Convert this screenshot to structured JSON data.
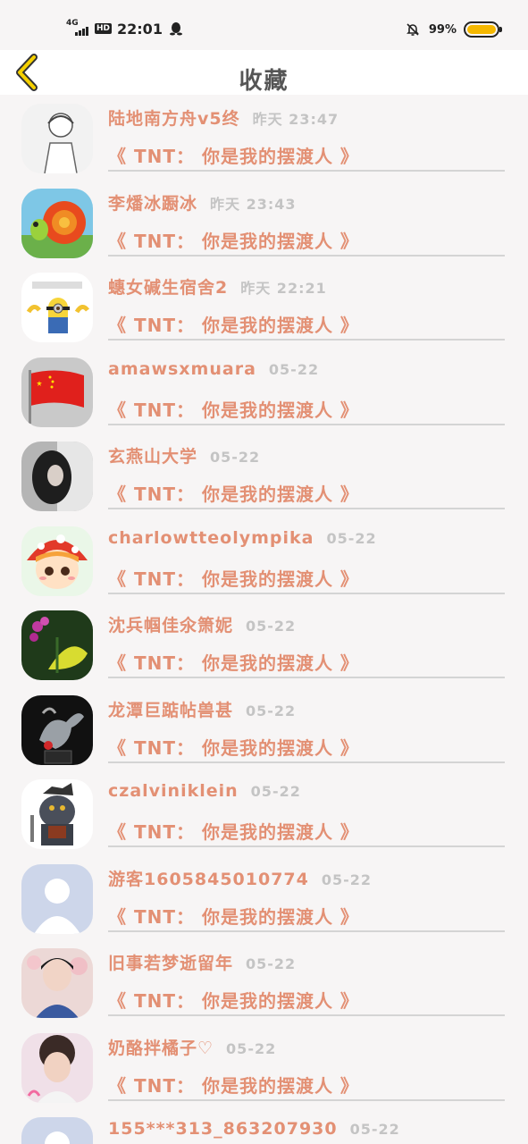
{
  "status_bar": {
    "network": "4G",
    "hd": "HD",
    "time": "22:01",
    "battery_pct": "99%",
    "battery_level": 0.99,
    "icons": [
      "signal-icon",
      "qq-penguin-icon",
      "bell-off-icon",
      "battery-icon"
    ]
  },
  "header": {
    "title": "收藏",
    "back_icon": "chevron-left-icon",
    "accent": "#f5d000"
  },
  "colors": {
    "name": "#e39074",
    "time": "#c4c4c4",
    "background": "#f7f5f5"
  },
  "items": [
    {
      "name": "陆地南方舟v5终",
      "time": "昨天 23:47",
      "book": "《 TNT： 你是我的摆渡人 》",
      "avatar": "sketch-boy"
    },
    {
      "name": "李燔冰蹰冰",
      "time": "昨天 23:43",
      "book": "《 TNT： 你是我的摆渡人 》",
      "avatar": "snail"
    },
    {
      "name": "蟪女碱生宿舍2",
      "time": "昨天 22:21",
      "book": "《 TNT： 你是我的摆渡人 》",
      "avatar": "minion"
    },
    {
      "name": "amawsxmuara",
      "time": "05-22",
      "book": "《 TNT： 你是我的摆渡人 》",
      "avatar": "flag"
    },
    {
      "name": "玄燕山大学",
      "time": "05-22",
      "book": "《 TNT： 你是我的摆渡人 》",
      "avatar": "girl-dark"
    },
    {
      "name": "charlowtteolympika",
      "time": "05-22",
      "book": "《 TNT： 你是我的摆渡人 》",
      "avatar": "mushroom-girl"
    },
    {
      "name": "沈兵帼佳氽箫妮",
      "time": "05-22",
      "book": "《 TNT： 你是我的摆渡人 》",
      "avatar": "butterfly"
    },
    {
      "name": "龙潭巨踮帖兽甚",
      "time": "05-22",
      "book": "《 TNT： 你是我的摆渡人 》",
      "avatar": "statue"
    },
    {
      "name": "czalviniklein",
      "time": "05-22",
      "book": "《 TNT： 你是我的摆渡人 》",
      "avatar": "warrior"
    },
    {
      "name": "游客1605845010774",
      "time": "05-22",
      "book": "《 TNT： 你是我的摆渡人 》",
      "avatar": "default"
    },
    {
      "name": "旧事若梦逝留年",
      "time": "05-22",
      "book": "《 TNT： 你是我的摆渡人 》",
      "avatar": "boy-blossom"
    },
    {
      "name": "奶酪拌橘子♡",
      "time": "05-22",
      "book": "《 TNT： 你是我的摆渡人 》",
      "avatar": "boy-curly"
    },
    {
      "name": "155***313_863207930",
      "time": "05-22",
      "book": "",
      "avatar": "default"
    }
  ]
}
